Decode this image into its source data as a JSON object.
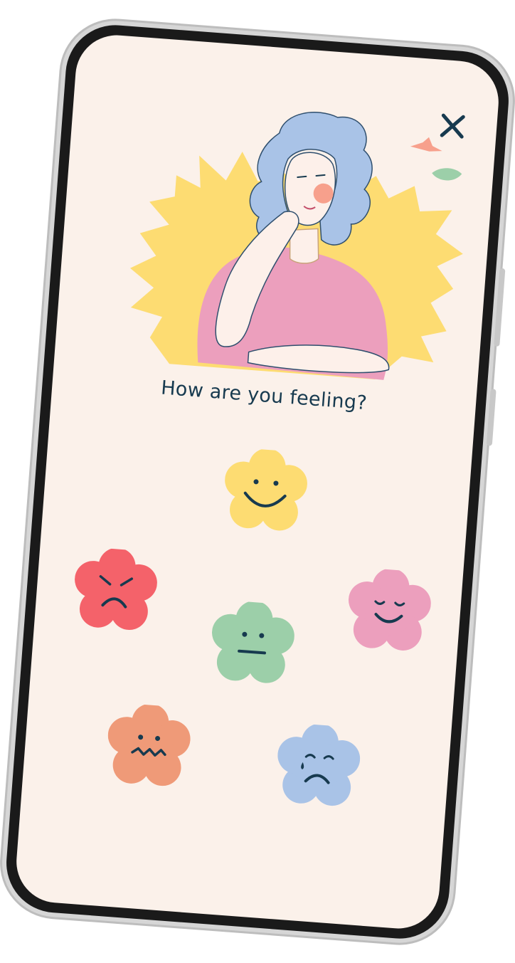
{
  "screen": {
    "question": "How are you feeling?",
    "close_icon": "close-icon",
    "illustration": "woman-resting-chin-illustration"
  },
  "moods": [
    {
      "icon": "happy-face-icon",
      "color": "#fddc72"
    },
    {
      "icon": "angry-face-icon",
      "color": "#f4626a"
    },
    {
      "icon": "content-face-icon",
      "color": "#ec9fbd"
    },
    {
      "icon": "neutral-face-icon",
      "color": "#9ccfa9"
    },
    {
      "icon": "anxious-face-icon",
      "color": "#ef9a78"
    },
    {
      "icon": "sad-tear-face-icon",
      "color": "#a9c3e7"
    }
  ],
  "colors": {
    "background": "#fbf1ea",
    "text": "#173a4f",
    "frame": "#1a1a1a"
  }
}
